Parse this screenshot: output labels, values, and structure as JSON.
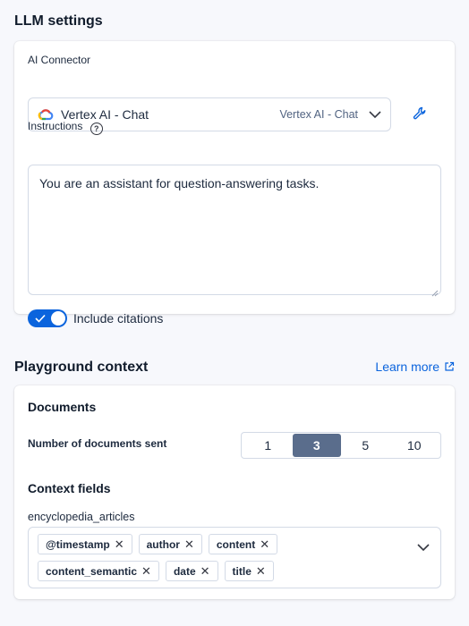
{
  "llm": {
    "title": "LLM settings",
    "connector_label": "AI Connector",
    "connector_name": "Vertex AI - Chat",
    "connector_value": "Vertex AI - Chat",
    "instructions_label": "Instructions",
    "help_glyph": "?",
    "instructions_text": "You are an assistant for question-answering tasks.",
    "citations_label": "Include citations",
    "citations_enabled": true
  },
  "context": {
    "title": "Playground context",
    "learn_more": "Learn more",
    "documents_title": "Documents",
    "num_docs_label": "Number of documents sent",
    "doc_options": [
      "1",
      "3",
      "5",
      "10"
    ],
    "selected_option": "3",
    "fields_title": "Context fields",
    "index_name": "encyclopedia_articles",
    "fields": [
      "@timestamp",
      "author",
      "content",
      "content_semantic",
      "date",
      "title"
    ],
    "remove_glyph": "✕"
  },
  "colors": {
    "accent": "#0b64dd",
    "selected_segment": "#5a6d8c"
  }
}
